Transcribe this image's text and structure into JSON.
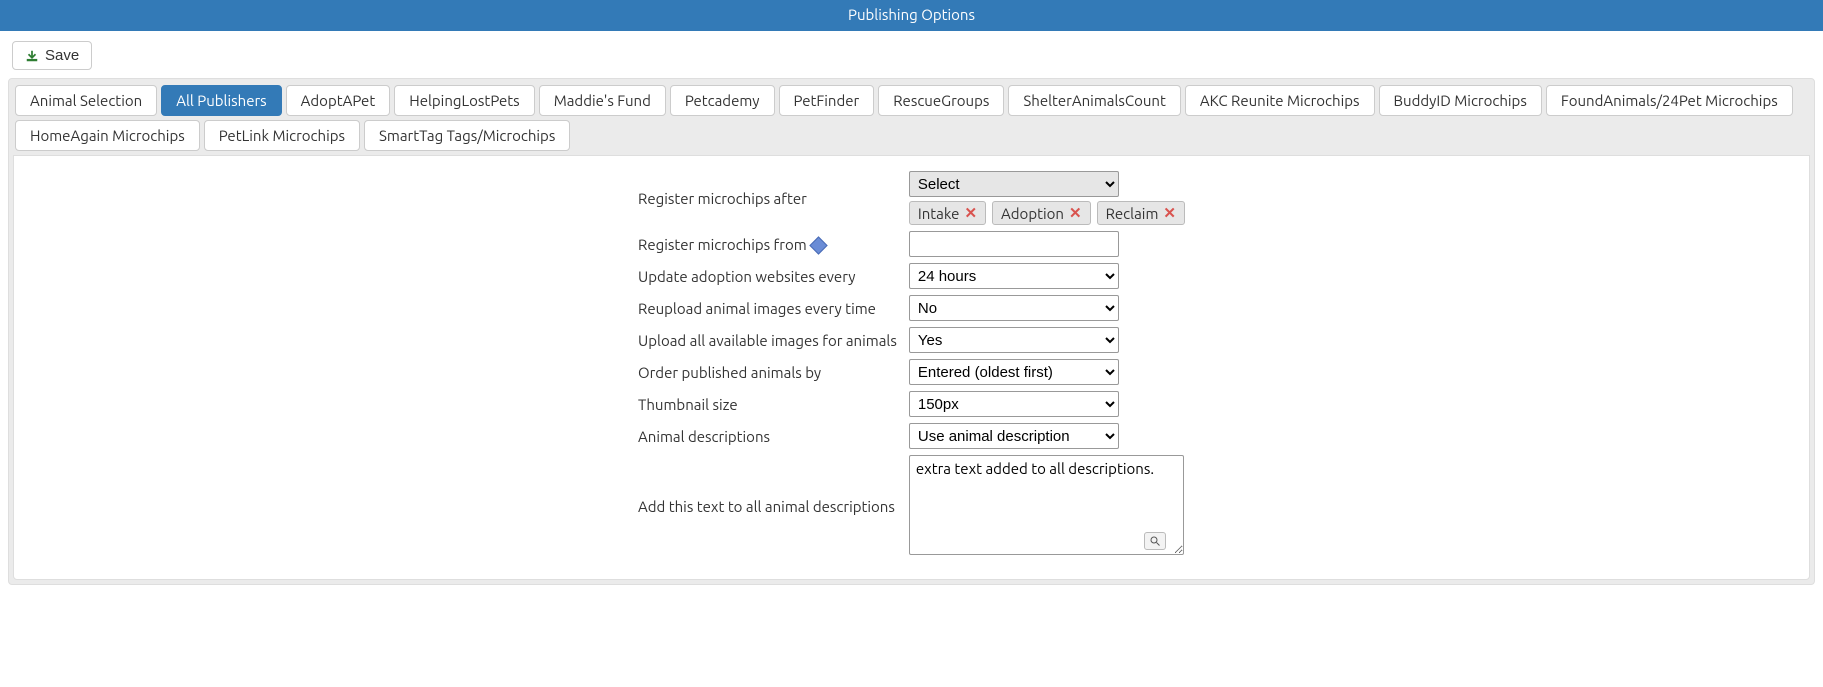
{
  "title": "Publishing Options",
  "toolbar": {
    "save_label": "Save"
  },
  "tabs": [
    "Animal Selection",
    "All Publishers",
    "AdoptAPet",
    "HelpingLostPets",
    "Maddie's Fund",
    "Petcademy",
    "PetFinder",
    "RescueGroups",
    "ShelterAnimalsCount",
    "AKC Reunite Microchips",
    "BuddyID Microchips",
    "FoundAnimals/24Pet Microchips",
    "HomeAgain Microchips",
    "PetLink Microchips",
    "SmartTag Tags/Microchips"
  ],
  "active_tab_index": 1,
  "form": {
    "register_after": {
      "label": "Register microchips after",
      "select_placeholder": "Select",
      "tags": [
        "Intake",
        "Adoption",
        "Reclaim"
      ]
    },
    "register_from": {
      "label": "Register microchips from",
      "value": ""
    },
    "update_every": {
      "label": "Update adoption websites every",
      "value": "24 hours"
    },
    "reupload": {
      "label": "Reupload animal images every time",
      "value": "No"
    },
    "upload_all": {
      "label": "Upload all available images for animals",
      "value": "Yes"
    },
    "order_by": {
      "label": "Order published animals by",
      "value": "Entered (oldest first)"
    },
    "thumb_size": {
      "label": "Thumbnail size",
      "value": "150px"
    },
    "descriptions": {
      "label": "Animal descriptions",
      "value": "Use animal description"
    },
    "extra_text": {
      "label": "Add this text to all animal descriptions",
      "value": "extra text added to all descriptions."
    }
  }
}
